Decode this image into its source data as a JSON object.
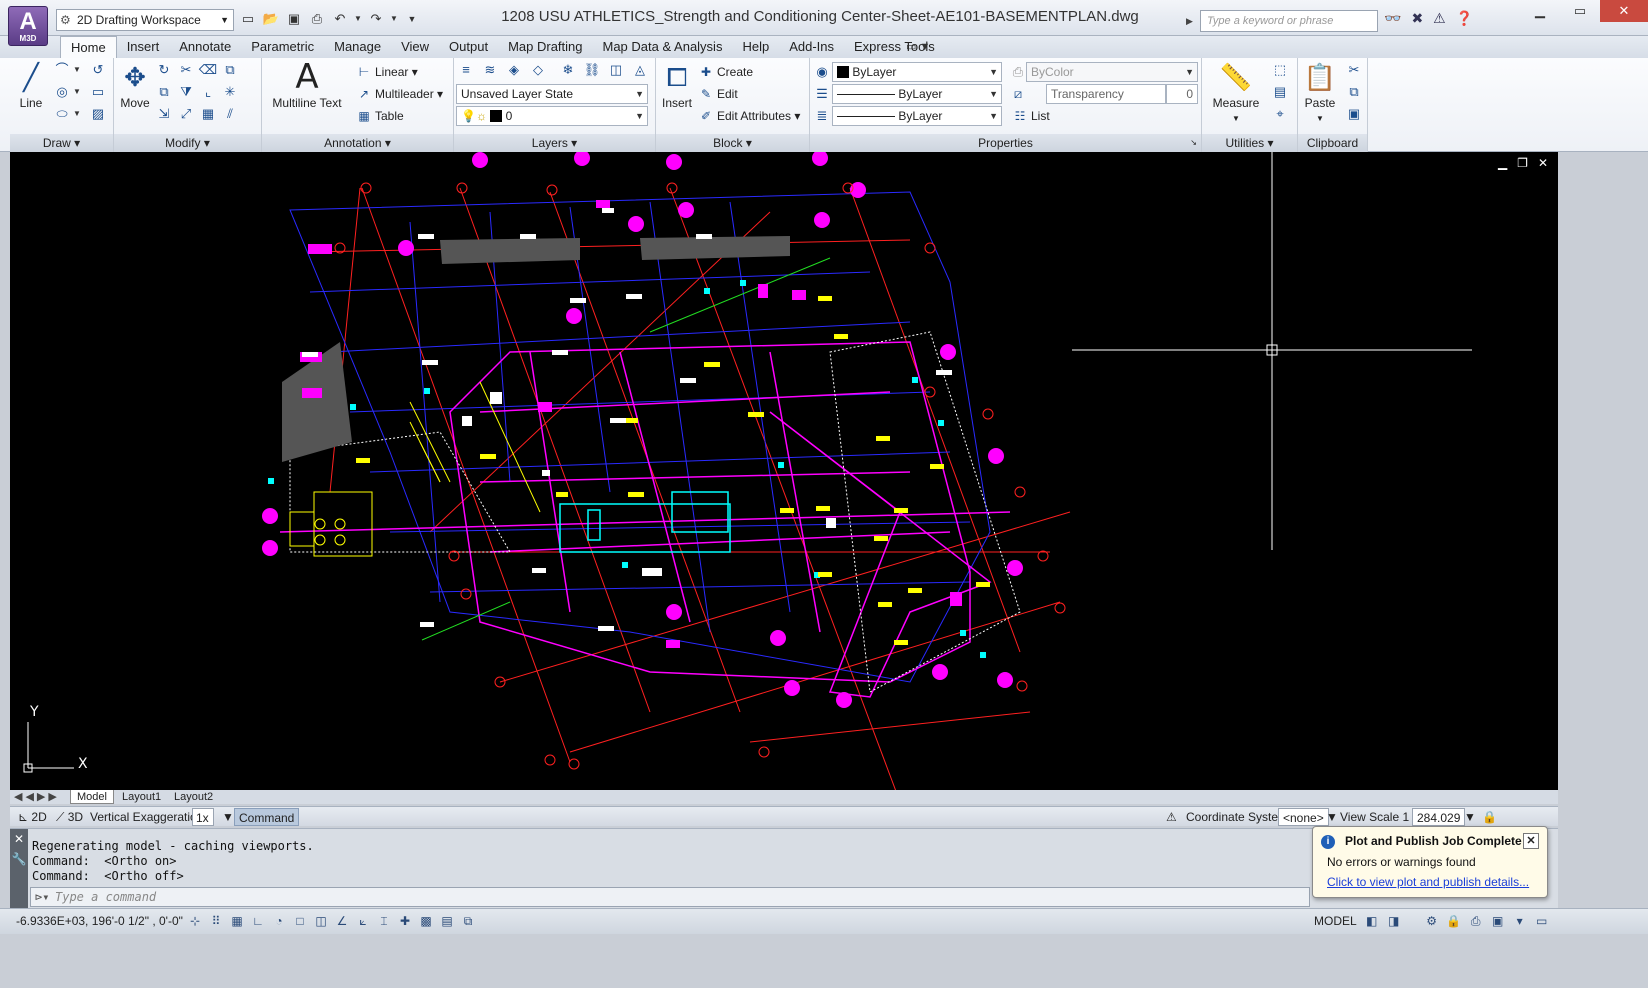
{
  "app": {
    "logo": "A",
    "logo_sub": "M3D",
    "document_title": "1208 USU ATHLETICS_Strength and Conditioning Center-Sheet-AE101-BASEMENTPLAN.dwg",
    "search_placeholder": "Type a keyword or phrase"
  },
  "workspace": {
    "value": "2D Drafting Workspace"
  },
  "qat": [
    "new-icon",
    "open-icon",
    "save-icon",
    "print-icon",
    "undo-icon",
    "redo-icon"
  ],
  "tabs": [
    "Home",
    "Insert",
    "Annotate",
    "Parametric",
    "Manage",
    "View",
    "Output",
    "Map Drafting",
    "Map Data & Analysis",
    "Help",
    "Add-Ins",
    "Express Tools"
  ],
  "active_tab": "Home",
  "ribbon": {
    "draw": {
      "title": "Draw",
      "line": "Line"
    },
    "modify": {
      "title": "Modify",
      "move": "Move"
    },
    "annotation": {
      "title": "Annotation",
      "multiline_text": "Multiline Text",
      "linear": "Linear",
      "multileader": "Multileader",
      "table": "Table"
    },
    "layers": {
      "title": "Layers",
      "layer_state": "Unsaved Layer State",
      "current_layer": "0"
    },
    "block": {
      "title": "Block",
      "insert": "Insert",
      "create": "Create",
      "edit": "Edit",
      "edit_attributes": "Edit Attributes"
    },
    "properties": {
      "title": "Properties",
      "color": "ByLayer",
      "linetype": "ByLayer",
      "lineweight": "ByLayer",
      "plot_style": "ByColor",
      "transparency_label": "Transparency",
      "transparency_value": "0",
      "list": "List"
    },
    "utilities": {
      "title": "Utilities",
      "measure": "Measure"
    },
    "clipboard": {
      "title": "Clipboard",
      "paste": "Paste"
    }
  },
  "layout_tabs": [
    "Model",
    "Layout1",
    "Layout2"
  ],
  "toolbar3d": {
    "btn_2d": "2D",
    "btn_3d": "3D",
    "vertical_exaggeration_label": "Vertical Exaggeration:",
    "vertical_exaggeration": "1x",
    "command_label": "Command",
    "coordinate_system_label": "Coordinate System:",
    "coordinate_system": "<none>",
    "view_scale_label": "View Scale  1 :",
    "view_scale": "284.029"
  },
  "command": {
    "history": [
      "Regenerating model - caching viewports.",
      "Command:  <Ortho on>",
      "Command:  <Ortho off>"
    ],
    "placeholder": "Type a command"
  },
  "status": {
    "coordinates": "-6.9336E+03, 196'-0 1/2\" , 0'-0\"",
    "model": "MODEL"
  },
  "notification": {
    "title": "Plot and Publish Job Complete",
    "message": "No errors or warnings found",
    "link": "Click to view plot and publish details..."
  },
  "colors": {
    "canvas": "#000000",
    "magenta": "#ff00ff",
    "blue": "#2323ff",
    "yellow": "#ffff00",
    "cyan": "#00ffff",
    "red": "#ff2020",
    "link": "#1a3ed8"
  }
}
